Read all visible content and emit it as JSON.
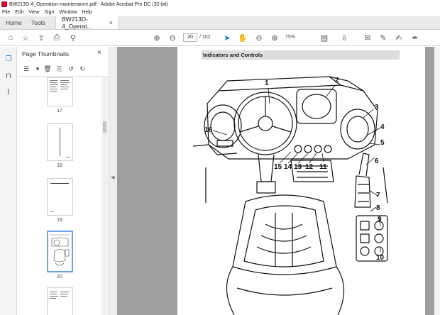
{
  "window": {
    "title": "BW213D-4_Operation-maintenance.pdf - Adobe Acrobat Pro DC (32-bit)"
  },
  "menu": [
    "File",
    "Edit",
    "View",
    "Sign",
    "Window",
    "Help"
  ],
  "tabs": {
    "home": "Home",
    "tools": "Tools",
    "document": "BW213D-4_Operat...",
    "close": "×"
  },
  "toolbar": {
    "current_page": "20",
    "page_count": "/ 102",
    "zoom": "75%"
  },
  "thumbnails_panel": {
    "title": "Page Thumbnails",
    "close": "×",
    "pages": [
      {
        "label": "17"
      },
      {
        "label": "18"
      },
      {
        "label": "19"
      },
      {
        "label": "20",
        "selected": true
      },
      {
        "label": ""
      }
    ]
  },
  "document": {
    "section_header": "Indicators and Controls",
    "callouts": [
      "1",
      "2",
      "3",
      "4",
      "5",
      "6",
      "7",
      "8",
      "9",
      "10",
      "11",
      "12",
      "13",
      "14",
      "15",
      "16"
    ]
  },
  "colors": {
    "accent": "#1473e6",
    "tab_bar": "#e9e9e9",
    "viewer_bg": "#9f9f9f",
    "selected_thumb": "#6aa0e8"
  }
}
